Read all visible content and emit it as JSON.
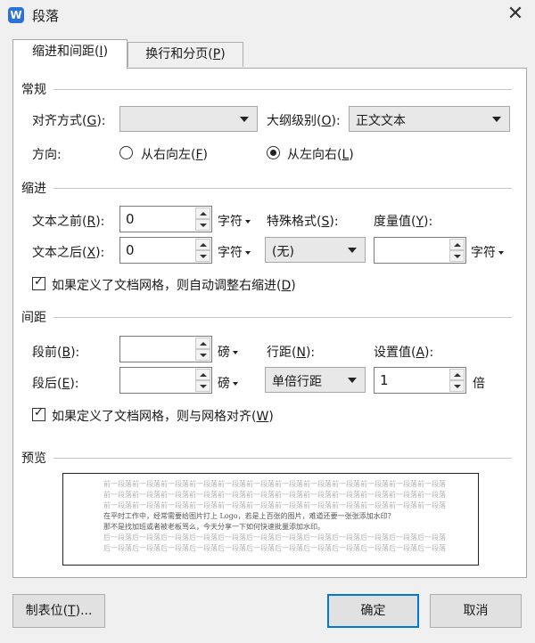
{
  "window": {
    "app_icon": "wps-writer-icon",
    "app_icon_glyph": "W",
    "title": "段落",
    "close_glyph": "✕"
  },
  "tabs": [
    {
      "label": "缩进和间距(",
      "key": "I",
      "suffix": ")",
      "active": true
    },
    {
      "label": "换行和分页(",
      "key": "P",
      "suffix": ")",
      "active": false
    }
  ],
  "general": {
    "title": "常规",
    "align_label": "对齐方式(",
    "align_key": "G",
    "align_suffix": "):",
    "align_value": "",
    "outline_label": "大纲级别(",
    "outline_key": "O",
    "outline_suffix": "):",
    "outline_value": "正文文本",
    "direction_label": "方向:",
    "rtl_label": "从右向左(",
    "rtl_key": "F",
    "rtl_suffix": ")",
    "ltr_label": "从左向右(",
    "ltr_key": "L",
    "ltr_suffix": ")",
    "selected_direction": "ltr"
  },
  "indent": {
    "title": "缩进",
    "before_label": "文本之前(",
    "before_key": "R",
    "before_suffix": "):",
    "before_value": "0",
    "before_unit": "字符",
    "after_label": "文本之后(",
    "after_key": "X",
    "after_suffix": "):",
    "after_value": "0",
    "after_unit": "字符",
    "special_label": "特殊格式(",
    "special_key": "S",
    "special_suffix": "):",
    "special_value": "(无)",
    "measure_label": "度量值(",
    "measure_key": "Y",
    "measure_suffix": "):",
    "measure_value": "",
    "measure_unit": "字符",
    "auto_adjust_label": "如果定义了文档网格，则自动调整右缩进(",
    "auto_adjust_key": "D",
    "auto_adjust_suffix": ")",
    "auto_adjust_checked": true
  },
  "spacing": {
    "title": "间距",
    "before_label": "段前(",
    "before_key": "B",
    "before_suffix": "):",
    "before_value": "",
    "before_unit": "磅",
    "after_label": "段后(",
    "after_key": "E",
    "after_suffix": "):",
    "after_value": "",
    "after_unit": "磅",
    "line_label": "行距(",
    "line_key": "N",
    "line_suffix": "):",
    "line_value": "单倍行距",
    "setting_label": "设置值(",
    "setting_key": "A",
    "setting_suffix": "):",
    "setting_value": "1",
    "setting_unit": "倍",
    "snap_label": "如果定义了文档网格，则与网格对齐(",
    "snap_key": "W",
    "snap_suffix": ")",
    "snap_checked": true
  },
  "preview": {
    "title": "预览",
    "lines_before": [
      "前一段落前一段落前一段落前一段落前一段落前一段落前一段落前一段落前一段落前一段落前一段落前一段落",
      "前一段落前一段落前一段落前一段落前一段落前一段落前一段落前一段落前一段落前一段落前一段落前一段落",
      "前一段落前一段落前一段落前一段落前一段落前一段落前一段落前一段落前一段落前一段落前一段落前一段落"
    ],
    "sample_lines": [
      "在平时工作中，经常需要给图片打上 Logo，若是上百张的图片，难道还要一张张添加水印？",
      "那不是找加班或者被老板骂么，今天分享一下如何快速批量添加水印。"
    ],
    "lines_after": [
      "后一段落后一段落后一段落后一段落后一段落后一段落后一段落后一段落后一段落后一段落后一段落后一段落",
      "后一段落后一段落后一段落后一段落后一段落后一段落后一段落后一段落后一段落后一段落后一段落后一段落"
    ]
  },
  "footer": {
    "tabs_button": "制表位(",
    "tabs_key": "T",
    "tabs_suffix": ")...",
    "ok_button": "确定",
    "cancel_button": "取消"
  }
}
